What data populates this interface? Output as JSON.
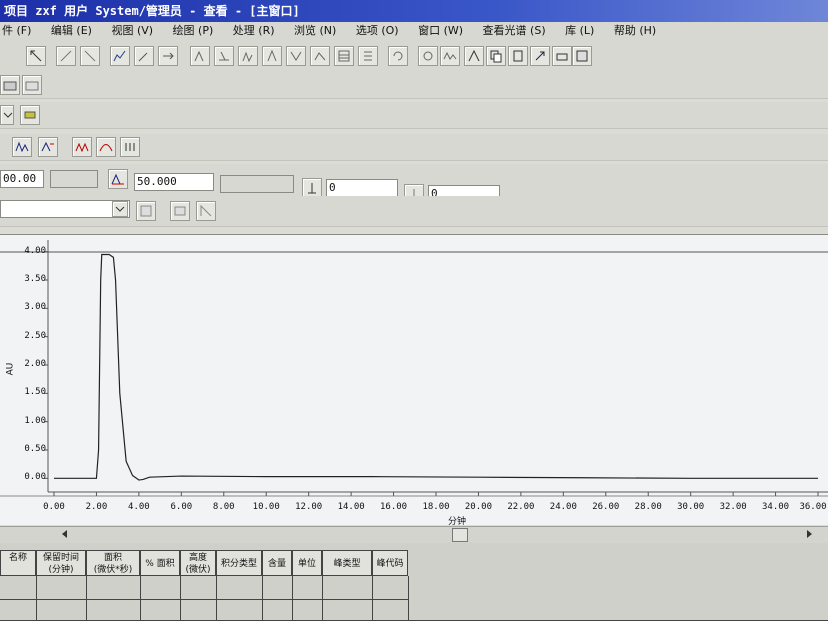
{
  "window": {
    "title": "项目 zxf 用户 System/管理员 - 查看 - [主窗口]"
  },
  "menu": [
    {
      "label": "件 (F)"
    },
    {
      "label": "编辑 (E)"
    },
    {
      "label": "视图 (V)"
    },
    {
      "label": "绘图 (P)"
    },
    {
      "label": "处理 (R)"
    },
    {
      "label": "浏览 (N)"
    },
    {
      "label": "选项 (O)"
    },
    {
      "label": "窗口 (W)"
    },
    {
      "label": "查看光谱 (S)"
    },
    {
      "label": "库 (L)"
    },
    {
      "label": "帮助 (H)"
    }
  ],
  "params": {
    "field1": "00.00",
    "field2": "50.000",
    "field3": "0",
    "field4": "0"
  },
  "chart_data": {
    "type": "line",
    "title": "",
    "xlabel": "分钟",
    "ylabel": "AU",
    "xlim": [
      0,
      36
    ],
    "ylim": [
      -0.1,
      4.1
    ],
    "x_ticks": [
      "0.00",
      "2.00",
      "4.00",
      "6.00",
      "8.00",
      "10.00",
      "12.00",
      "14.00",
      "16.00",
      "18.00",
      "20.00",
      "22.00",
      "24.00",
      "26.00",
      "28.00",
      "30.00",
      "32.00",
      "34.00",
      "36.00"
    ],
    "y_ticks": [
      "0.00",
      "0.50",
      "1.00",
      "1.50",
      "2.00",
      "2.50",
      "3.00",
      "3.50",
      "4.00"
    ],
    "series": [
      {
        "x": [
          0,
          2.0,
          2.1,
          2.2,
          2.25,
          2.6,
          2.8,
          2.9,
          3.1,
          3.4,
          3.7,
          4.0,
          4.2,
          4.5,
          6,
          10,
          15,
          20,
          25,
          30,
          36
        ],
        "y": [
          0.0,
          0.0,
          0.5,
          3.5,
          3.95,
          3.95,
          3.9,
          3.5,
          1.5,
          0.3,
          0.05,
          -0.03,
          -0.02,
          0.02,
          0.04,
          0.03,
          0.03,
          0.02,
          0.01,
          0.0,
          0.0
        ]
      }
    ]
  },
  "results_table": {
    "headers": [
      "名称",
      "保留时间\n(分钟)",
      "面积\n(微伏*秒)",
      "% 面积",
      "高度\n(微伏)",
      "积分类型",
      "含量",
      "单位",
      "峰类型",
      "峰代码"
    ]
  }
}
